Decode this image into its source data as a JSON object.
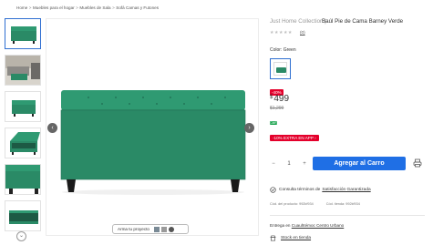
{
  "breadcrumb": {
    "items": [
      "Home",
      "Muebles para el hogar",
      "Muebles de Sala",
      "Sofá Camas y Futones"
    ],
    "separator": ">"
  },
  "gallery": {
    "thumbnails": [
      "thumb-ottoman-front",
      "thumb-ottoman-room",
      "thumb-ottoman-side",
      "thumb-ottoman-open",
      "thumb-ottoman-closeup",
      "thumb-ottoman-interior"
    ],
    "active_index": 0,
    "more_icon": "chevron-down-icon",
    "prev_icon": "chevron-left-icon",
    "next_icon": "chevron-right-icon"
  },
  "ar": {
    "label": "Arma tu proyecto",
    "icons": [
      "room-icon",
      "ar-cube-icon",
      "view-360-icon"
    ]
  },
  "product": {
    "brand": "Just Home Collection |",
    "title": "Baúl Pie de Cama Barney Verde",
    "stars_icon": "star-icon",
    "rating": 0,
    "review_count": "(0)",
    "color_label": "Color: Green",
    "discount": "-40%",
    "currency": "$",
    "price": "499",
    "old_price": "$1,299",
    "green_tag": "CMR",
    "promo": "-10% EXTRA EN APP ›",
    "quantity": "1",
    "minus": "−",
    "plus": "+",
    "add_to_cart": "Agregar al Carro",
    "print_icon": "printer-icon"
  },
  "details": {
    "guarantee_prefix": "Consulta términos de",
    "guarantee_link": "Satisfacción Garantizada",
    "product_code": "Cód. del producto: 992kf934",
    "store_code": "Cód. tienda: 992kf934",
    "delivery_prefix": "Entrega en",
    "delivery_link": "Cuauhtémoc Centro Urbano",
    "stock_link": "Stock en tienda"
  },
  "colors": {
    "accent": "#1f6fe5",
    "sale": "#e4002b",
    "product_green": "#2a8a66",
    "badge_green": "#15a14a"
  }
}
